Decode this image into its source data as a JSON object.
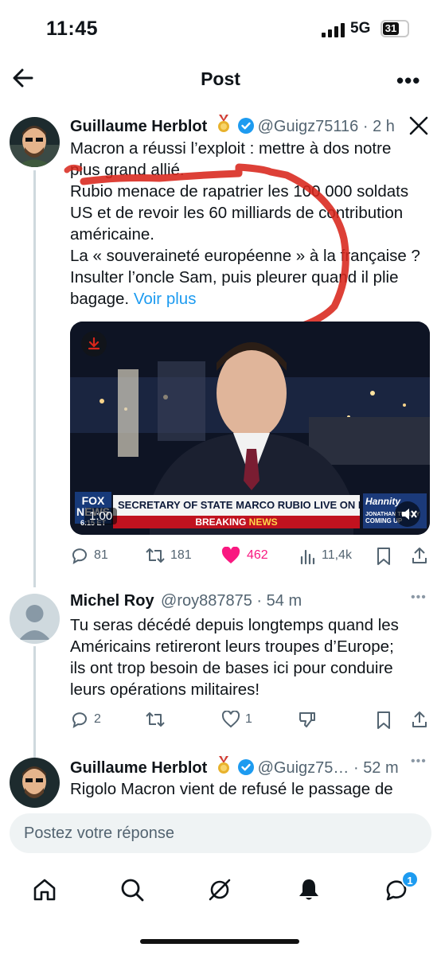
{
  "status": {
    "time": "11:45",
    "network": "5G",
    "battery": "31"
  },
  "header": {
    "title": "Post"
  },
  "main_post": {
    "name": "Guillaume Herblot",
    "handle": "@Guigz75116",
    "time": "2 h",
    "lines": [
      "Macron a réussi l’exploit : mettre à dos notre",
      "plus grand allié.",
      "Rubio menace de rapatrier les 100 000 soldats",
      "US et de revoir les 60 milliards de contribution",
      "américaine.",
      "La « souveraineté européenne » à la française ?",
      "Insulter l’oncle Sam, puis pleurer quand il plie",
      "bagage."
    ],
    "see_more": "Voir plus",
    "video": {
      "duration": "1:00",
      "ticker": "SECRETARY OF STATE MARCO RUBIO LIVE ON HANNITY",
      "breaking_a": "BREAKING",
      "breaking_b": "NEWS",
      "channel": "FOX",
      "channel_sub": "NEWS",
      "clock": "6:15 ET",
      "show": "Hannity",
      "coming_up": "COMING UP",
      "guest": "JONATHAN TURLEY"
    },
    "stats": {
      "replies": "81",
      "reposts": "181",
      "likes": "462",
      "views": "11,4k"
    }
  },
  "reply1": {
    "name": "Michel Roy",
    "handle": "@roy887875",
    "time": "54 m",
    "lines": [
      "Tu seras décédé depuis longtemps quand les",
      "Américains retireront leurs troupes d’Europe;",
      "ils ont trop besoin de bases ici pour conduire",
      "leurs opérations militaires!"
    ],
    "stats": {
      "replies": "2",
      "likes": "1"
    }
  },
  "reply2": {
    "name": "Guillaume Herblot",
    "handle": "@Guigz75…",
    "time": "52 m",
    "lines": [
      "Rigolo Macron vient de refusé le passage de"
    ]
  },
  "composer": {
    "placeholder": "Postez votre réponse"
  },
  "tabbar": {
    "notif_badge": "1"
  },
  "colors": {
    "blue": "#1d9bf0",
    "like": "#f91880",
    "grey": "#536471",
    "annotation_red": "#d8261b"
  }
}
